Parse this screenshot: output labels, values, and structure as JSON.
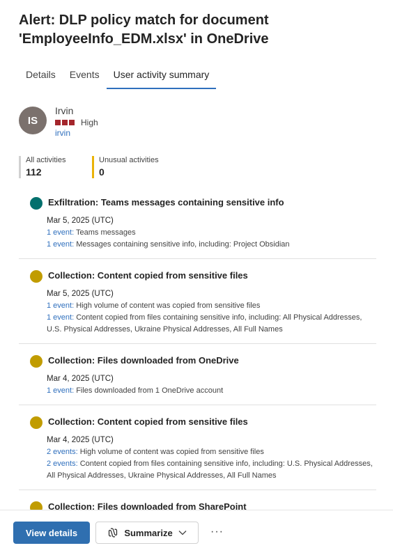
{
  "title": "Alert: DLP policy match for document 'EmployeeInfo_EDM.xlsx' in OneDrive",
  "tabs": [
    {
      "label": "Details"
    },
    {
      "label": "Events"
    },
    {
      "label": "User activity summary"
    }
  ],
  "user": {
    "initials": "IS",
    "name": "Irvin",
    "risk_level": "High",
    "link": "irvin",
    "risk_color": "#a4262c"
  },
  "stats": {
    "all_label": "All activities",
    "all_value": "112",
    "unusual_label": "Unusual activities",
    "unusual_value": "0"
  },
  "events": [
    {
      "title": "Exfiltration: Teams messages containing sensitive info",
      "color": "#03706d",
      "date": "Mar 5, 2025 (UTC)",
      "lines": [
        {
          "link": "1 event:",
          "text": " Teams messages"
        },
        {
          "link": "1 event:",
          "text": " Messages containing sensitive info, including: Project Obsidian"
        }
      ]
    },
    {
      "title": "Collection: Content copied from sensitive files",
      "color": "#c19c00",
      "date": "Mar 5, 2025 (UTC)",
      "lines": [
        {
          "link": "1 event:",
          "text": " High volume of content was copied from sensitive files"
        },
        {
          "link": "1 event:",
          "text": " Content copied from files containing sensitive info, including: All Physical Addresses, U.S. Physical Addresses, Ukraine Physical Addresses, All Full Names"
        }
      ]
    },
    {
      "title": "Collection: Files downloaded from OneDrive",
      "color": "#c19c00",
      "date": "Mar 4, 2025 (UTC)",
      "lines": [
        {
          "link": "1 event:",
          "text": " Files downloaded from 1 OneDrive account"
        }
      ]
    },
    {
      "title": "Collection: Content copied from sensitive files",
      "color": "#c19c00",
      "date": "Mar 4, 2025 (UTC)",
      "lines": [
        {
          "link": "2 events:",
          "text": " High volume of content was copied from sensitive files"
        },
        {
          "link": "2 events:",
          "text": " Content copied from files containing sensitive info, including: U.S. Physical Addresses, All Physical Addresses, Ukraine Physical Addresses, All Full Names"
        }
      ]
    },
    {
      "title": "Collection: Files downloaded from SharePoint",
      "color": "#c19c00",
      "date": "",
      "lines": []
    }
  ],
  "footer": {
    "view_details": "View details",
    "summarize": "Summarize",
    "more": "···",
    "primary_color": "#2f6fb0"
  }
}
